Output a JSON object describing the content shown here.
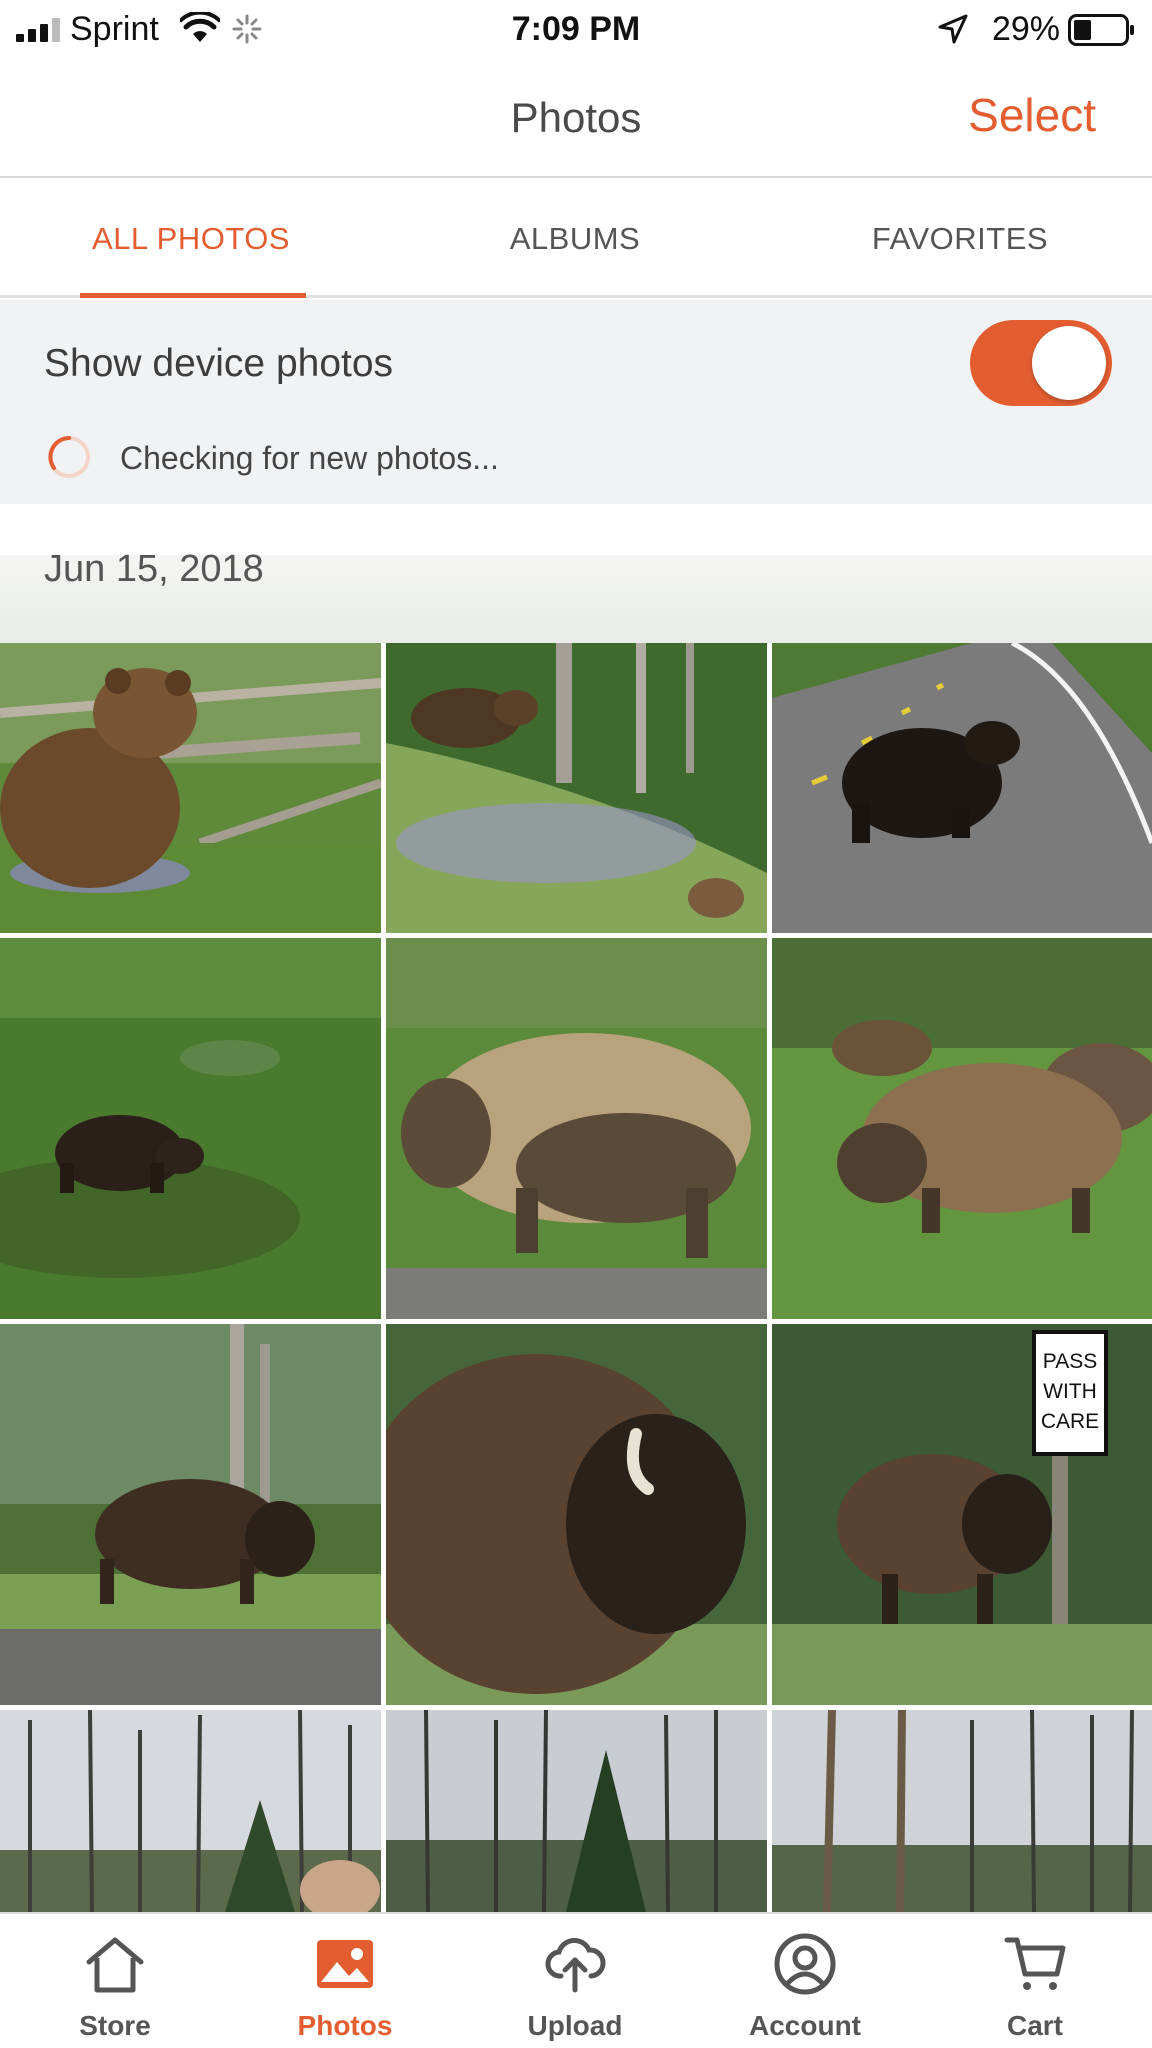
{
  "status_bar": {
    "carrier": "Sprint",
    "time": "7:09 PM",
    "battery_percent": "29%",
    "icons": [
      "signal-icon",
      "wifi-icon",
      "activity-spinner-icon",
      "location-arrow-icon",
      "battery-icon"
    ]
  },
  "header": {
    "title": "Photos",
    "select_label": "Select"
  },
  "tabs": [
    {
      "label": "ALL PHOTOS",
      "active": true
    },
    {
      "label": "ALBUMS",
      "active": false
    },
    {
      "label": "FAVORITES",
      "active": false
    }
  ],
  "device_photos": {
    "label": "Show device photos",
    "toggle_on": true,
    "status": "Checking for new photos..."
  },
  "photo_groups": [
    {
      "date": "Jun 15, 2018"
    }
  ],
  "bottom_nav": [
    {
      "label": "Store",
      "icon": "home-icon",
      "active": false
    },
    {
      "label": "Photos",
      "icon": "photos-icon",
      "active": true
    },
    {
      "label": "Upload",
      "icon": "upload-cloud-icon",
      "active": false
    },
    {
      "label": "Account",
      "icon": "account-icon",
      "active": false
    },
    {
      "label": "Cart",
      "icon": "cart-icon",
      "active": false
    }
  ],
  "colors": {
    "accent": "#e35d31",
    "panel_bg": "#f1f2f4",
    "text": "#4a4a4a"
  }
}
